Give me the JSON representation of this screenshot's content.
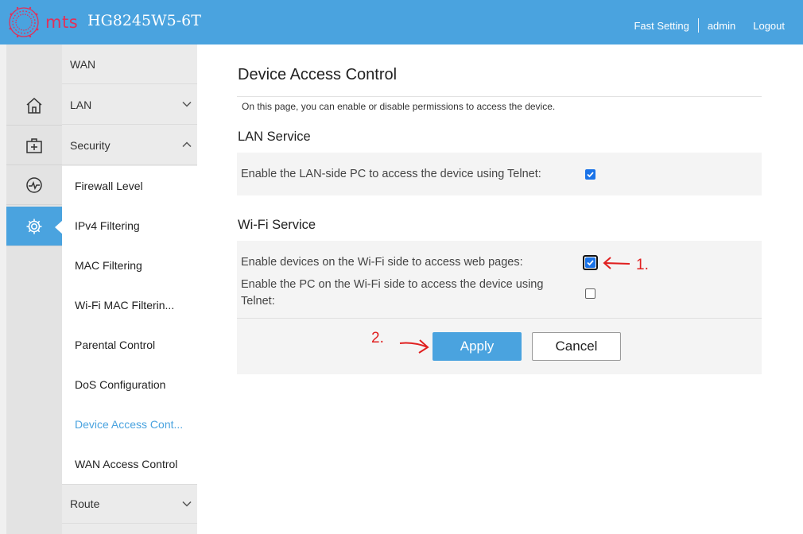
{
  "header": {
    "brand": "mts",
    "model": "HG8245W5-6T",
    "nav": [
      "Fast Setting",
      "admin",
      "Logout"
    ]
  },
  "iconbar": {
    "icons": [
      "home-icon",
      "medical-kit-icon",
      "pulse-monitor-icon",
      "gear-icon"
    ],
    "active_index": 3
  },
  "menu": {
    "top_items": [
      {
        "label": "WAN"
      },
      {
        "label": "LAN"
      },
      {
        "label": "Security"
      }
    ],
    "security_items": [
      "Firewall Level",
      "IPv4 Filtering",
      "MAC Filtering",
      "Wi-Fi MAC Filterin...",
      "Parental Control",
      "DoS Configuration",
      "Device Access Cont...",
      "WAN Access Control"
    ],
    "active_sub_index": 6,
    "bottom_items": [
      {
        "label": "Route"
      }
    ]
  },
  "main": {
    "title": "Device Access Control",
    "description": "On this page, you can enable or disable permissions to access the device.",
    "lan_section": {
      "title": "LAN Service",
      "telnet_label": "Enable the LAN-side PC to access the device using Telnet:",
      "telnet_checked": true
    },
    "wifi_section": {
      "title": "Wi-Fi Service",
      "web_label": "Enable devices on the Wi-Fi side to access web pages:",
      "web_checked": true,
      "telnet_label_line1": "Enable the PC on the Wi-Fi side to access the device using",
      "telnet_label_line2": "Telnet:",
      "telnet_checked": false
    },
    "buttons": {
      "apply": "Apply",
      "cancel": "Cancel"
    },
    "annotations": {
      "step1": "1.",
      "step2": "2."
    }
  },
  "colors": {
    "header_bg": "#4aa3df",
    "brand": "#e0315a",
    "active_link": "#4aa3df",
    "checkbox": "#1a73e8",
    "annotation": "#e02020"
  }
}
